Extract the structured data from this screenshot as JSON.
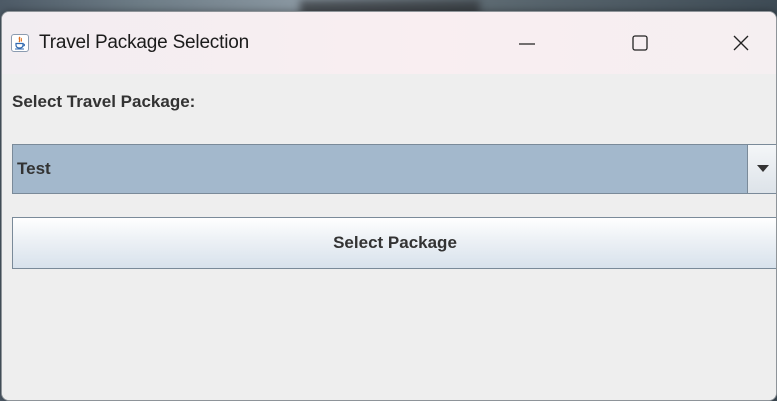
{
  "window": {
    "title": "Travel Package Selection",
    "controls": {
      "minimize": "minimize-icon",
      "maximize": "maximize-icon",
      "close": "close-icon"
    }
  },
  "form": {
    "label": "Select Travel Package:",
    "combo": {
      "selected_value": "Test",
      "arrow_icon": "caret-down-icon"
    },
    "submit_label": "Select Package"
  },
  "colors": {
    "combo_fill": "#a3b8cc",
    "text": "#333333",
    "window_bg": "#eeeeee"
  }
}
